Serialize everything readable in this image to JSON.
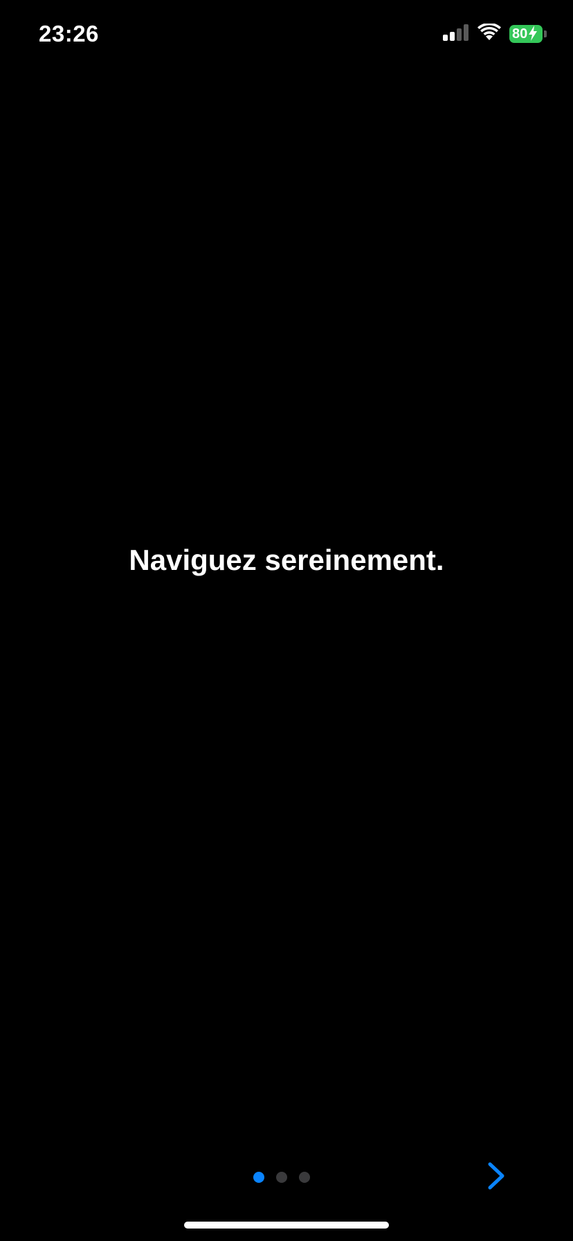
{
  "status_bar": {
    "time": "23:26",
    "battery_level": "80",
    "battery_charging": true,
    "signal_bars_active": 2,
    "signal_bars_total": 4,
    "wifi": true
  },
  "main": {
    "headline": "Naviguez sereinement."
  },
  "pager": {
    "total_pages": 3,
    "current_page": 1
  },
  "navigation": {
    "next_icon": "chevron-right-icon"
  },
  "colors": {
    "background": "#000000",
    "text": "#ffffff",
    "accent": "#0a84ff",
    "inactive_dot": "#3a3a3c",
    "battery": "#34c759"
  }
}
